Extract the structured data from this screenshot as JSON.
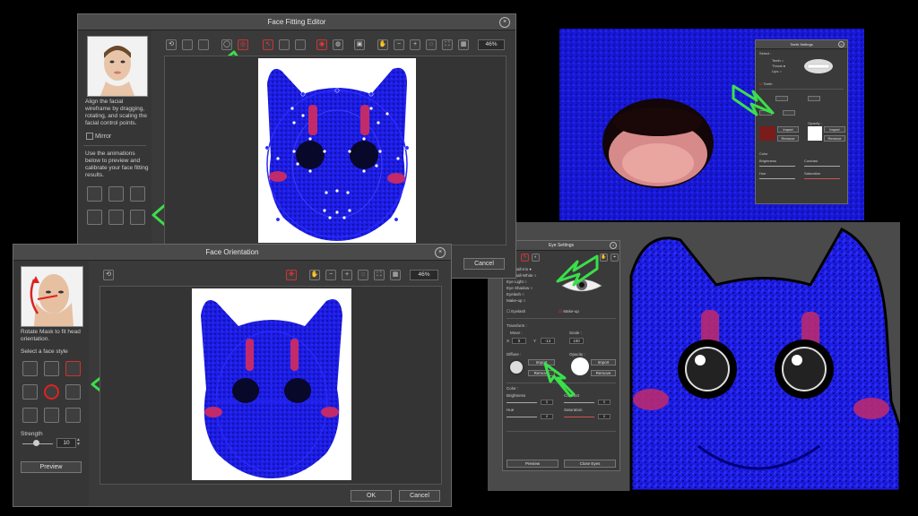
{
  "face_fitting_editor": {
    "title": "Face Fitting Editor",
    "instructions": "Align the facial wireframe by dragging, rotating, and scaling the facial control points.",
    "mirror_label": "Mirror",
    "animations_text": "Use the animations below to preview and calibrate your face fitting results.",
    "zoom": "46%",
    "cancel_label": "Cancel"
  },
  "face_orientation": {
    "title": "Face Orientation",
    "instructions": "Rotate Mask to fit head orientation.",
    "face_style_label": "Select a face style",
    "strength_label": "Strength",
    "strength_value": "10",
    "preview_label": "Preview",
    "zoom": "46%",
    "ok_label": "OK",
    "cancel_label": "Cancel"
  },
  "teeth_settings": {
    "title": "Teeth Settings",
    "select_label": "Select :",
    "options": [
      "Teeth",
      "Throat",
      "Lips"
    ],
    "teeth_checkbox": "Teeth",
    "import_label": "Import",
    "remove_label": "Remove",
    "opacity_label": "Opacity :",
    "color_label": "Color",
    "brightness_label": "Brightness",
    "contrast_label": "Contrast",
    "hue_label": "Hue",
    "saturation_label": "Saturation"
  },
  "eye_settings": {
    "title": "Eye Settings",
    "parts": [
      "Eye Ball-Iris",
      "Eye Ball-White",
      "Eye Light",
      "Eye Shadow",
      "Eyelash",
      "Make-up"
    ],
    "eyelash_label": "Eyelash",
    "makeup_label": "Make-up",
    "transform_label": "Transform :",
    "move_label": "Move :",
    "scale_label": "Scale :",
    "move_x_label": "X",
    "move_x": "0",
    "move_y_label": "Y",
    "move_y": "-14",
    "scale": "100",
    "diffuse_label": "Diffuse :",
    "opacity_label": "Opacity :",
    "import_label": "Import",
    "remove_label": "Remove",
    "color_label": "Color :",
    "brightness_label": "Brightness",
    "contrast_label": "Contrast",
    "hue_label": "Hue",
    "saturation_label": "Saturation",
    "value_zero": "0",
    "preview_label": "Preview",
    "close_label": "Close Eyes"
  },
  "colors": {
    "mask_blue": "#1c1cf0",
    "highlight_green": "#3adf4a",
    "stripe_pink": "#c22a6a",
    "dialog_bg": "#3a3a3a"
  }
}
